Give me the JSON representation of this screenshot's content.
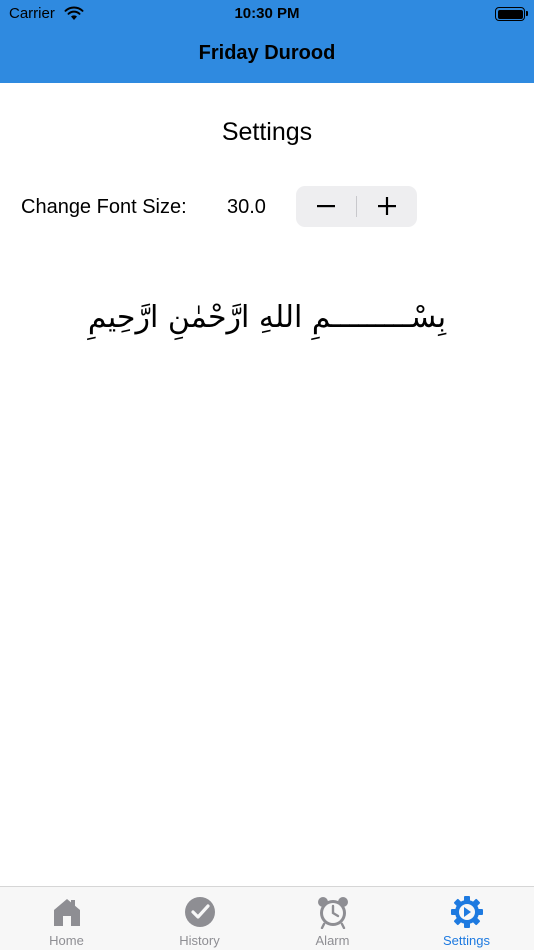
{
  "status_bar": {
    "carrier": "Carrier",
    "time": "10:30 PM"
  },
  "nav": {
    "title": "Friday Durood"
  },
  "settings": {
    "heading": "Settings",
    "font_size_label": "Change Font Size:",
    "font_size_value": "30.0",
    "arabic_sample": "بِسْـــــــــمِ اللهِ ارَّحْمٰنِ ارَّحِيمِ"
  },
  "tabs": [
    {
      "label": "Home",
      "icon": "home-icon",
      "active": false
    },
    {
      "label": "History",
      "icon": "checkmark-circle-icon",
      "active": false
    },
    {
      "label": "Alarm",
      "icon": "alarm-clock-icon",
      "active": false
    },
    {
      "label": "Settings",
      "icon": "gear-icon",
      "active": true
    }
  ],
  "colors": {
    "nav_bar": "#2F8AE0",
    "active_tab": "#1E7AE0",
    "inactive_tab": "#8E8E93"
  }
}
